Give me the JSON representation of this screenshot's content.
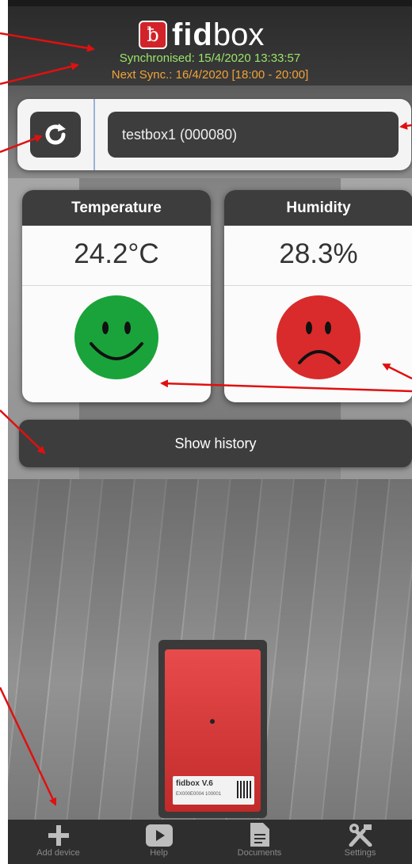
{
  "header": {
    "logo_letter": "ƀ",
    "logo_fid": "fid",
    "logo_box": "box",
    "synchronised": "Synchronised: 15/4/2020 13:33:57",
    "next_sync": "Next Sync.: 16/4/2020 [18:00 - 20:00]"
  },
  "device_bar": {
    "refresh_icon": "refresh-icon",
    "selected_device": "testbox1 (000080)"
  },
  "cards": {
    "temperature": {
      "title": "Temperature",
      "value": "24.2°C",
      "status": "happy",
      "color": "#1aa33a"
    },
    "humidity": {
      "title": "Humidity",
      "value": "28.3%",
      "status": "sad",
      "color": "#d92b2b"
    }
  },
  "history_button": "Show history",
  "device_image": {
    "label_brand": "fidbox V.6",
    "label_code": "EX000E0004 100001"
  },
  "bottom_nav": [
    {
      "icon": "plus-icon",
      "label": "Add device"
    },
    {
      "icon": "play-icon",
      "label": "Help"
    },
    {
      "icon": "document-icon",
      "label": "Documents"
    },
    {
      "icon": "tools-icon",
      "label": "Settings"
    }
  ],
  "colors": {
    "accent_red": "#d2232a",
    "sync_green": "#9be56a",
    "sync_orange": "#f0a33a",
    "annotation_red": "#e01010"
  }
}
